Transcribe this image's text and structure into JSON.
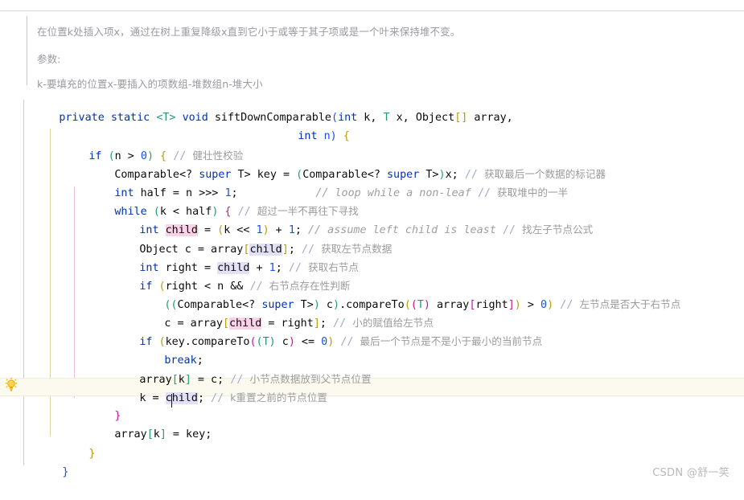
{
  "editor": {
    "app": "IntelliJ IDEA Java Editor",
    "language": "Java"
  },
  "javadoc": {
    "line1": "在位置k处插入项x，通过在树上重复降级x直到它小于或等于其子项或是一个叶来保持堆不变。",
    "line2": "参数:",
    "line3": "k-要填充的位置x-要插入的项数组-堆数组n-堆大小"
  },
  "gutter": {
    "intention_icon": "lightbulb-icon"
  },
  "code": {
    "l01": {
      "kw1": "private",
      "kw2": "static",
      "generic": "<T>",
      "kw3": "void",
      "method": "siftDownComparable",
      "paren_open": "(",
      "t_int": "int",
      "p_k": " k, ",
      "t_T": "T",
      "p_x": " x, ",
      "t_obj": "Object",
      "brk": "[]",
      "p_arr": " array,"
    },
    "l02": {
      "t_int": "int",
      "p_n": " n)",
      "brace": " {"
    },
    "l03": {
      "kw": "if",
      "cond_open": "(",
      "cond": "n > ",
      "zero": "0",
      "cond_close": ")",
      "brace": " {",
      "comment_slash": "// ",
      "comment": "健壮性校验"
    },
    "l04": {
      "type1": "Comparable<? ",
      "super1": "super",
      "t1": " T> ",
      "var": "key = ",
      "cast_open": "(",
      "type2": "Comparable<? ",
      "super2": "super",
      "t2": " T>",
      "cast_close": ")",
      "rest": "x;",
      "comment_slash": " // ",
      "comment": "获取最后一个数据的标记器"
    },
    "l05": {
      "kw": "int",
      "expr": " half = n >>> ",
      "num": "1",
      "semi": ";",
      "pad": "            ",
      "comment_en": "// loop while a non-leaf",
      "comment_slash": " // ",
      "comment": "获取堆中的一半"
    },
    "l06": {
      "kw": "while",
      "paren_open": " (",
      "cond": "k < half",
      "paren_close": ")",
      "brace": " {",
      "comment_slash": " // ",
      "comment": "超过一半不再往下寻找"
    },
    "l07": {
      "kw": "int",
      "sp": " ",
      "ident": "child",
      "eq": " = ",
      "paren_open": "(",
      "expr": "k << ",
      "num1": "1",
      "paren_close": ")",
      "plus": " + ",
      "num2": "1",
      "semi": ";",
      "comment_en": " // assume left child is least",
      "comment_slash": " // ",
      "comment": "找左子节点公式"
    },
    "l08": {
      "type": "Object",
      "var": " c = array",
      "brk_open": "[",
      "ident": "child",
      "brk_close": "]",
      "semi": ";",
      "comment_slash": " // ",
      "comment": "获取左节点数据"
    },
    "l09": {
      "kw": "int",
      "var": " right = ",
      "ident": "child",
      "plus": " + ",
      "num": "1",
      "semi": ";",
      "comment_slash": " // ",
      "comment": "获取右节点"
    },
    "l10": {
      "kw": "if",
      "paren_open": " (",
      "cond": "right < n && ",
      "comment_slash": "// ",
      "comment": "右节点存在性判断"
    },
    "l11": {
      "p1": "((",
      "type": "Comparable<? ",
      "super": "super",
      "t": " T>",
      "p2": ")",
      "c": " c",
      "p3": ")",
      "method": ".compareTo",
      "p4": "(",
      "p5": "(",
      "T": "T",
      "p6": ")",
      "arr": " array",
      "b1": "[",
      "right": "right",
      "b2": "]",
      "p7": ")",
      "gt": " > ",
      "zero": "0",
      "p8": ")",
      "comment_slash": " // ",
      "comment": "左节点是否大于右节点"
    },
    "l12": {
      "pre": "c = array",
      "b1": "[",
      "ident": "child",
      "eq": " = right",
      "b2": "]",
      "semi": ";",
      "comment_slash": " // ",
      "comment": "小的赋值给左节点"
    },
    "l13": {
      "kw": "if",
      "p1": " (",
      "expr": "key.compareTo",
      "p2": "(",
      "p3": "(",
      "T": "T",
      "p4": ")",
      "c": " c",
      "p5": ")",
      "le": " <= ",
      "zero": "0",
      "p6": ")",
      "comment_slash": " // ",
      "comment": "最后一个节点是不是小于最小的当前节点"
    },
    "l14": {
      "kw": "break",
      "semi": ";"
    },
    "l15": {
      "pre": "array",
      "b1": "[",
      "k": "k",
      "b2": "]",
      "post": " = c;",
      "comment_slash": " // ",
      "comment": "小节点数据放到父节点位置"
    },
    "l16": {
      "pre": "k = ",
      "ident_a": "c",
      "ident_b": "hild",
      "semi": ";",
      "comment_slash": " // ",
      "comment": "k重置之前的节点位置"
    },
    "l17": {
      "brace": "}"
    },
    "l18": {
      "pre": "array",
      "b1": "[",
      "k": "k",
      "b2": "]",
      "post": " = key;"
    },
    "l19": {
      "brace": "}"
    },
    "l20": {
      "brace": "}"
    }
  },
  "watermark": {
    "text": "CSDN @舒一笑"
  },
  "colors": {
    "keyword": "#0033b3",
    "number": "#1750eb",
    "comment": "#8c8c8c",
    "string_generic": "#20997a",
    "caret_line": "#fcfaef",
    "highlight_write": "#fbd3e8",
    "highlight_read": "#e2e0f7",
    "guide_blue": "#c5d0de",
    "guide_olive": "#d9d3a6",
    "guide_pink": "#eec0e3"
  }
}
